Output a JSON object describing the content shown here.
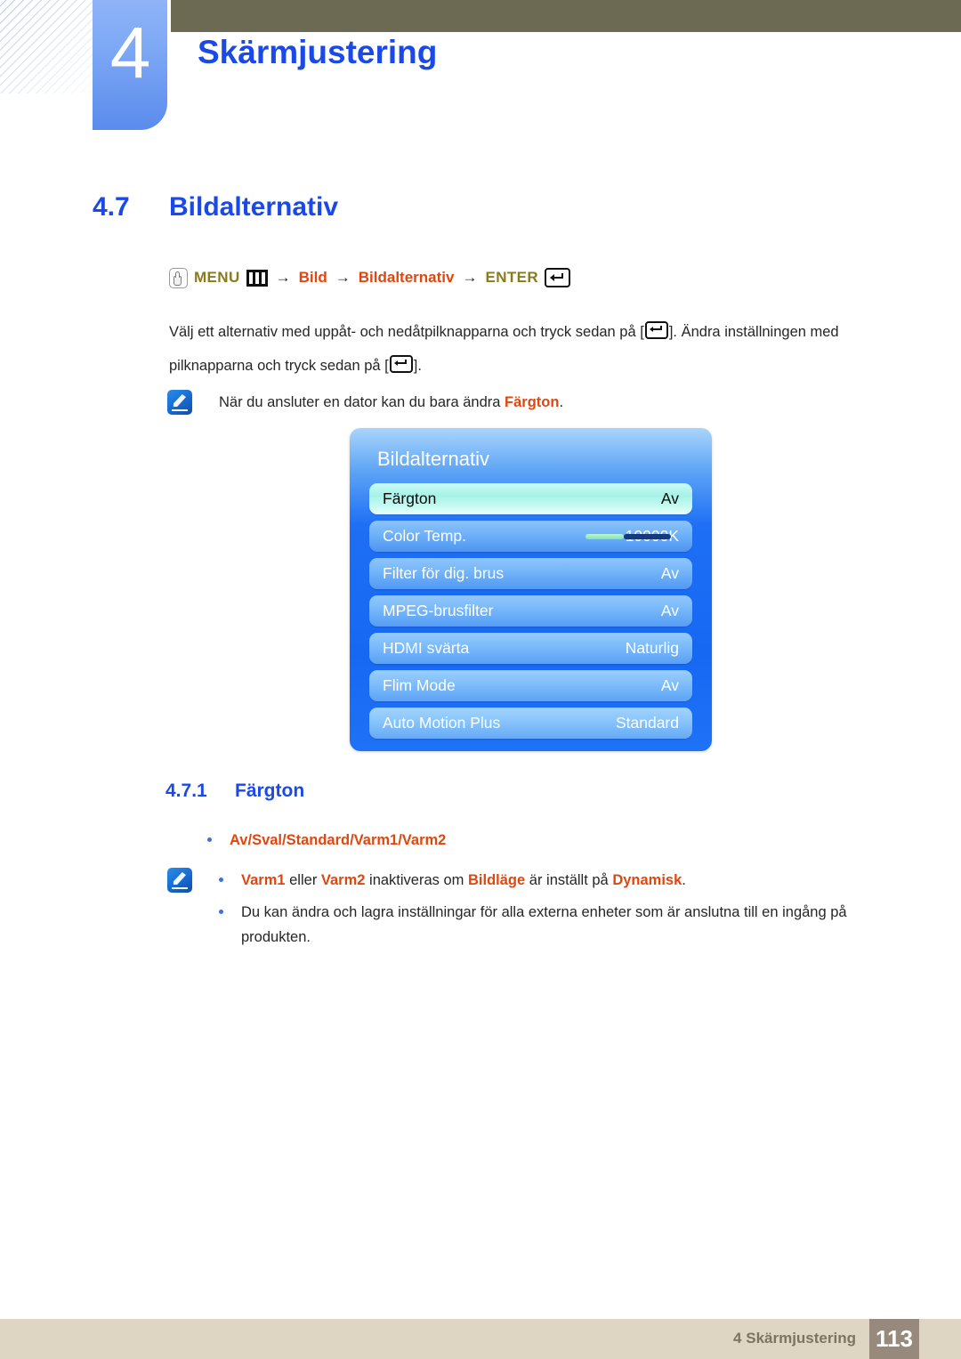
{
  "header": {
    "chapter_number": "4",
    "chapter_title": "Skärmjustering"
  },
  "section": {
    "number": "4.7",
    "title": "Bildalternativ"
  },
  "breadcrumb": {
    "hand_icon": "hand-press-icon",
    "menu_label": "MENU",
    "menu_icon": "menu-grid-icon",
    "arrow1": "→",
    "item1": "Bild",
    "arrow2": "→",
    "item2": "Bildalternativ",
    "arrow3": "→",
    "enter_label": "ENTER",
    "enter_icon": "enter-key-icon"
  },
  "body": {
    "paragraph_part1": "Välj ett alternativ med uppåt- och nedåtpilknapparna och tryck sedan på [",
    "paragraph_part2": "]. Ändra inställningen med pilknapparna och tryck sedan på [",
    "paragraph_part3": "]."
  },
  "note1": {
    "icon": "note-pen-icon",
    "text_part1": "När du ansluter en dator kan du bara ändra ",
    "highlight": "Färgton",
    "text_part2": "."
  },
  "osd": {
    "title": "Bildalternativ",
    "rows": [
      {
        "label": "Färgton",
        "value": "Av",
        "selected": true,
        "has_slider": false
      },
      {
        "label": "Color Temp.",
        "value": "10000K",
        "selected": false,
        "has_slider": true,
        "slider_percent": 45
      },
      {
        "label": "Filter för dig. brus",
        "value": "Av",
        "selected": false,
        "has_slider": false
      },
      {
        "label": "MPEG-brusfilter",
        "value": "Av",
        "selected": false,
        "has_slider": false
      },
      {
        "label": "HDMI svärta",
        "value": "Naturlig",
        "selected": false,
        "has_slider": false
      },
      {
        "label": "Flim Mode",
        "value": "Av",
        "selected": false,
        "has_slider": false
      },
      {
        "label": "Auto Motion Plus",
        "value": "Standard",
        "selected": false,
        "has_slider": false
      }
    ]
  },
  "subsection": {
    "number": "4.7.1",
    "title": "Färgton"
  },
  "options_bullet": {
    "text": "Av/Sval/Standard/Varm1/Varm2"
  },
  "note2": {
    "icon": "note-pen-icon",
    "bullet1": {
      "hl1": "Varm1",
      "mid1": " eller ",
      "hl2": "Varm2",
      "mid2": " inaktiveras om ",
      "hl3": "Bildläge",
      "mid3": " är inställt på ",
      "hl4": "Dynamisk",
      "end": "."
    },
    "bullet2": {
      "text": "Du kan ändra och lagra inställningar för alla externa enheter som är anslutna till en ingång på produkten."
    }
  },
  "footer": {
    "text": "4 Skärmjustering",
    "page": "113"
  },
  "colors": {
    "heading_blue": "#1a49e8",
    "accent_orange": "#e2460f",
    "menu_olive": "#8a7a1e",
    "top_bar_olive": "#6d6a54",
    "footer_bar": "#ded5c3",
    "footer_page_box": "#97897b",
    "osd_blue": "#1e6ff5",
    "osd_selected": "#a6f2e8",
    "slider_fill": "#7fe5b0",
    "slider_rest": "#16397f"
  }
}
